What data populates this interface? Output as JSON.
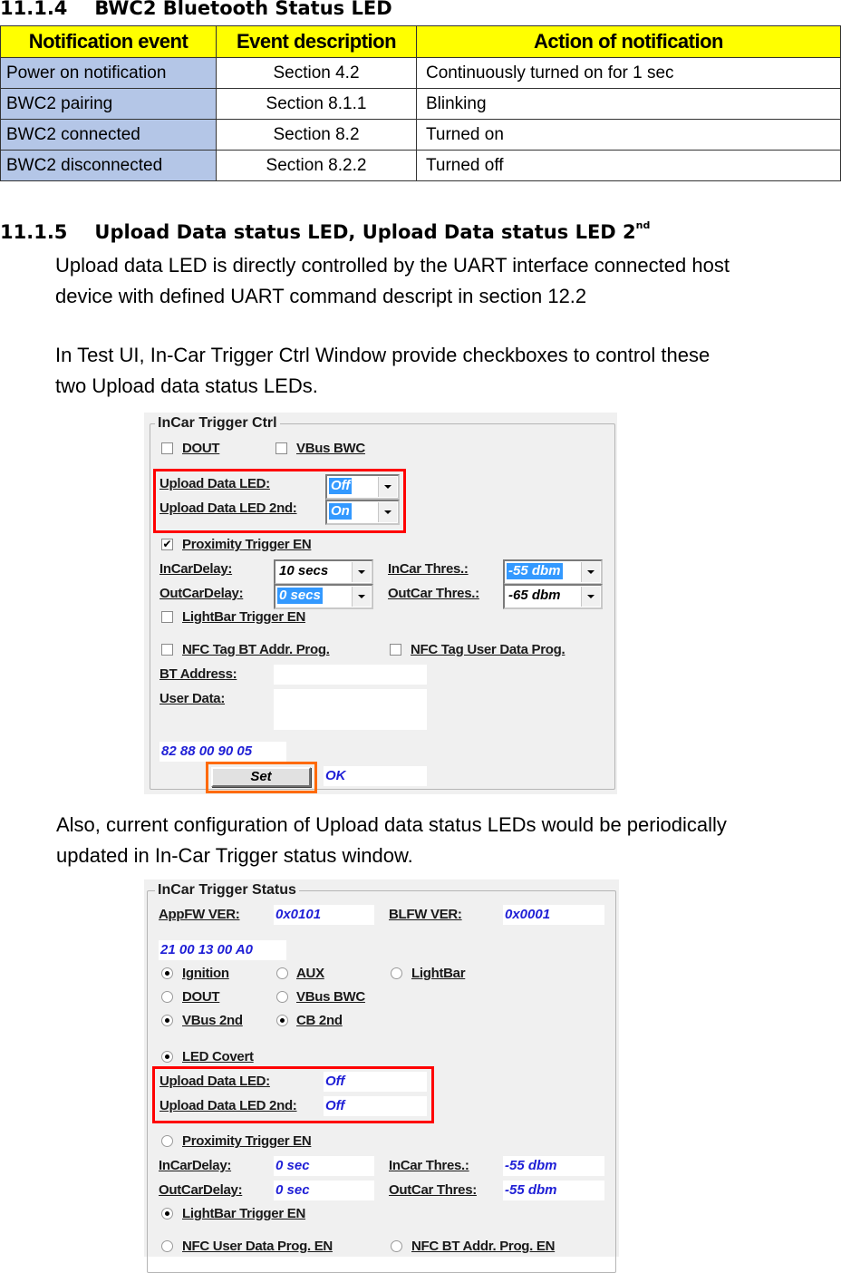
{
  "section_1114": {
    "number": "11.1.4",
    "title": "BWC2 Bluetooth Status LED"
  },
  "notification_table": {
    "headers": [
      "Notification event",
      "Event description",
      "Action of notification"
    ],
    "rows": [
      {
        "event": "Power on notification",
        "description": "Section 4.2",
        "action": "Continuously turned on for 1 sec"
      },
      {
        "event": "BWC2 pairing",
        "description": "Section 8.1.1",
        "action": "Blinking"
      },
      {
        "event": "BWC2 connected",
        "description": "Section 8.2",
        "action": "Turned on"
      },
      {
        "event": "BWC2 disconnected",
        "description": "Section 8.2.2",
        "action": "Turned off"
      }
    ],
    "colors": {
      "header_bg": "#ffff00",
      "event_col_bg": "#b4c6e7"
    }
  },
  "section_1115": {
    "number": "11.1.5",
    "title": "Upload Data status LED, Upload Data status LED 2",
    "title_sup": "nd",
    "paragraph1_line1": "Upload data LED is directly controlled by the UART interface connected host",
    "paragraph1_line2": "device with defined UART command descript in section 12.2",
    "paragraph2_line1": "In Test UI, In-Car Trigger Ctrl Window provide checkboxes to control these",
    "paragraph2_line2": "two Upload data status LEDs.",
    "paragraph3_line1": "Also, current configuration of Upload data status LEDs would be periodically",
    "paragraph3_line2": "updated in In-Car Trigger status window."
  },
  "ctrl_window": {
    "title": "InCar Trigger Ctrl",
    "dout": {
      "label": "DOUT",
      "checked": false
    },
    "vbus_bwc": {
      "label": "VBus BWC",
      "checked": false
    },
    "upload_led": {
      "label": "Upload Data LED:",
      "value": "Off"
    },
    "upload_led_2nd": {
      "label": "Upload Data LED 2nd:",
      "value": "On"
    },
    "proximity": {
      "label": "Proximity Trigger EN",
      "checked": true,
      "check_glyph": "✔"
    },
    "incar_delay": {
      "label": "InCarDelay:",
      "value": "10 secs"
    },
    "outcar_delay": {
      "label": "OutCarDelay:",
      "value": "0 secs"
    },
    "incar_thres": {
      "label": "InCar Thres.:",
      "value": "-55 dbm"
    },
    "outcar_thres": {
      "label": "OutCar Thres.:",
      "value": "-65 dbm"
    },
    "lightbar": {
      "label": "LightBar Trigger EN",
      "checked": false
    },
    "nfc_bt_addr": {
      "label": "NFC Tag BT Addr. Prog.",
      "checked": false
    },
    "nfc_user_data": {
      "label": "NFC Tag User Data Prog.",
      "checked": false
    },
    "bt_address": {
      "label": "BT Address:",
      "value": ""
    },
    "user_data": {
      "label": "User Data:",
      "value": ""
    },
    "hex_output": "82 88 00 90 05",
    "set_button": "Set",
    "status": "OK",
    "highlight_colors": {
      "leds": "#ff0000",
      "set_button": "#ff6a00"
    }
  },
  "status_window": {
    "title": "InCar Trigger Status",
    "appfw": {
      "label": "AppFW VER:",
      "value": "0x0101"
    },
    "blfw": {
      "label": "BLFW VER:",
      "value": "0x0001"
    },
    "hex_output": "21 00 13 00 A0",
    "radios": [
      {
        "label": "Ignition",
        "on": true
      },
      {
        "label": "AUX",
        "on": false
      },
      {
        "label": "LightBar",
        "on": false
      },
      {
        "label": "DOUT",
        "on": false
      },
      {
        "label": "VBus BWC",
        "on": false
      },
      {
        "label": "VBus 2nd",
        "on": true
      },
      {
        "label": "CB 2nd",
        "on": true
      }
    ],
    "led_covert": {
      "label": "LED Covert",
      "on": true
    },
    "upload_led": {
      "label": "Upload Data LED:",
      "value": "Off"
    },
    "upload_led_2nd": {
      "label": "Upload Data LED 2nd:",
      "value": "Off"
    },
    "proximity": {
      "label": "Proximity Trigger EN",
      "on": false
    },
    "incar_delay": {
      "label": "InCarDelay:",
      "value": "0 sec"
    },
    "outcar_delay": {
      "label": "OutCarDelay:",
      "value": "0 sec"
    },
    "incar_thres": {
      "label": "InCar Thres.:",
      "value": "-55 dbm"
    },
    "outcar_thres": {
      "label": "OutCar Thres:",
      "value": "-55 dbm"
    },
    "lightbar": {
      "label": "LightBar Trigger EN",
      "on": true
    },
    "nfc_user_data": {
      "label": "NFC User Data Prog. EN",
      "on": false
    },
    "nfc_bt_addr": {
      "label": "NFC BT Addr. Prog. EN",
      "on": false
    }
  }
}
